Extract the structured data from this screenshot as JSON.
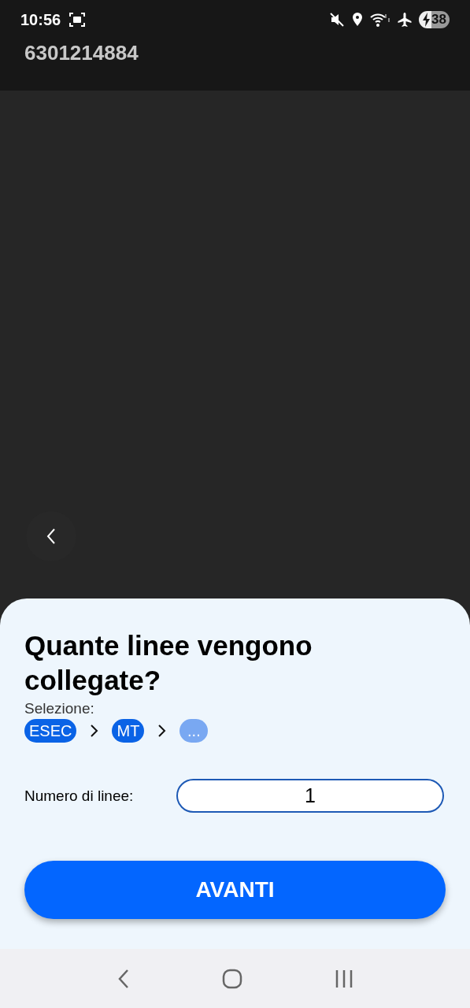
{
  "status_bar": {
    "time": "10:56",
    "battery": "38"
  },
  "header": {
    "title": "6301214884"
  },
  "sheet": {
    "title": "Quante linee vengono collegate?",
    "selection_label": "Selezione:",
    "breadcrumb": [
      {
        "label": "ESEC",
        "done": true
      },
      {
        "label": "MT",
        "done": true
      },
      {
        "label": "...",
        "done": false
      }
    ],
    "field": {
      "label": "Numero di linee:",
      "value": "1"
    },
    "button": "AVANTI"
  }
}
